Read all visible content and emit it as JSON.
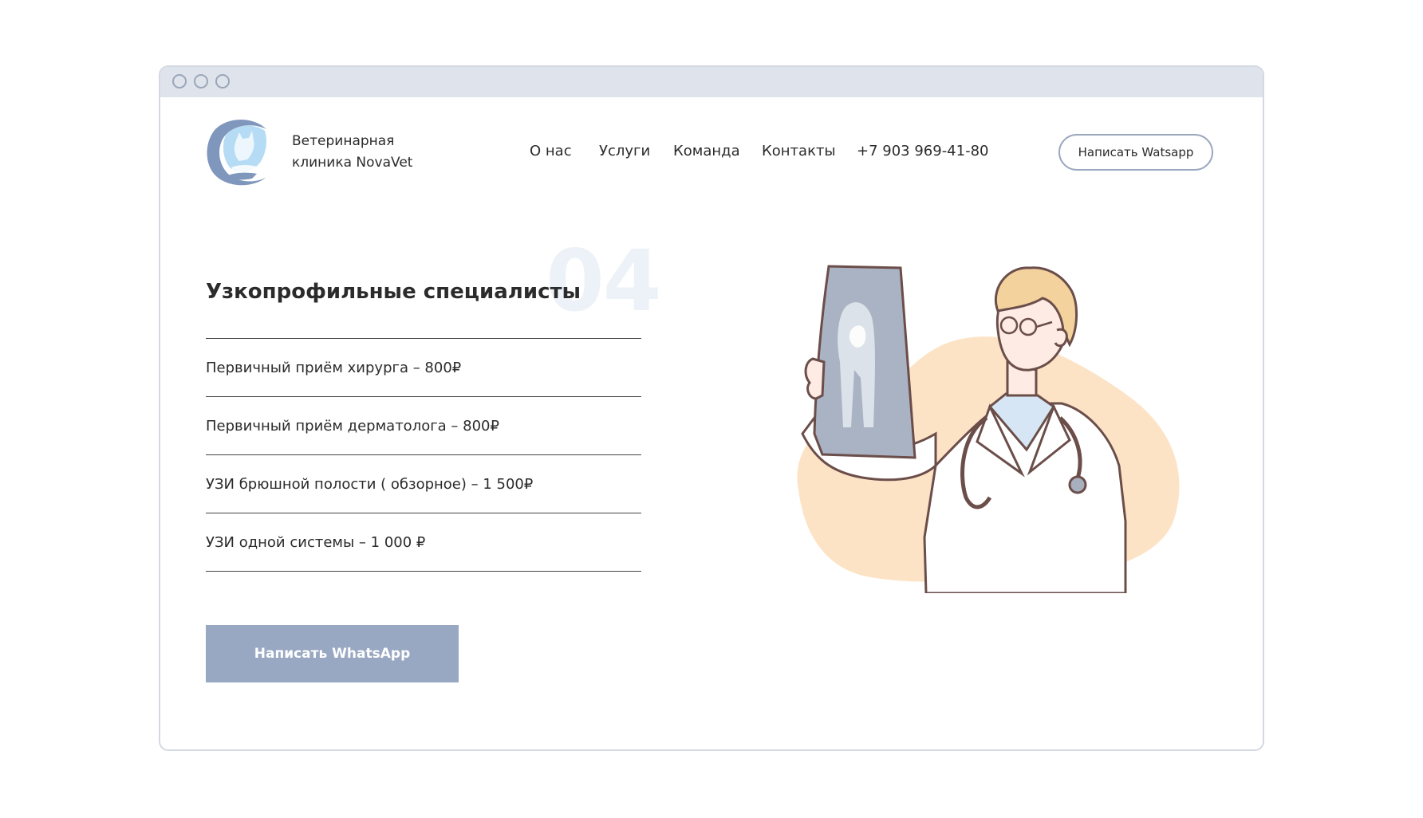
{
  "brand": {
    "name_line1": "Ветеринарная",
    "name_line2": "клиника NovaVet",
    "logo_icon": "cat-dog-in-hand-logo"
  },
  "nav": {
    "items": [
      "О нас",
      "Услуги",
      "Команда",
      "Контакты"
    ],
    "phone": "+7 903 969-41-80",
    "cta_label": "Написать Watsapp"
  },
  "section": {
    "number": "04",
    "title": "Узкопрофильные специалисты",
    "services": [
      "Первичный приём хирурга – 800₽",
      "Первичный приём дерматолога – 800₽",
      "УЗИ брюшной полости ( обзорное) – 1 500₽",
      "УЗИ одной системы – 1 000 ₽"
    ],
    "cta_label": "Написать WhatsApp"
  },
  "illustration": {
    "icon": "doctor-with-xray-illustration"
  },
  "colors": {
    "accent": "#99a8c2",
    "titlebar": "#dfe4ec",
    "blob": "#fde3c6",
    "logo_blue": "#7f97bc",
    "logo_light": "#b6dcf5"
  }
}
